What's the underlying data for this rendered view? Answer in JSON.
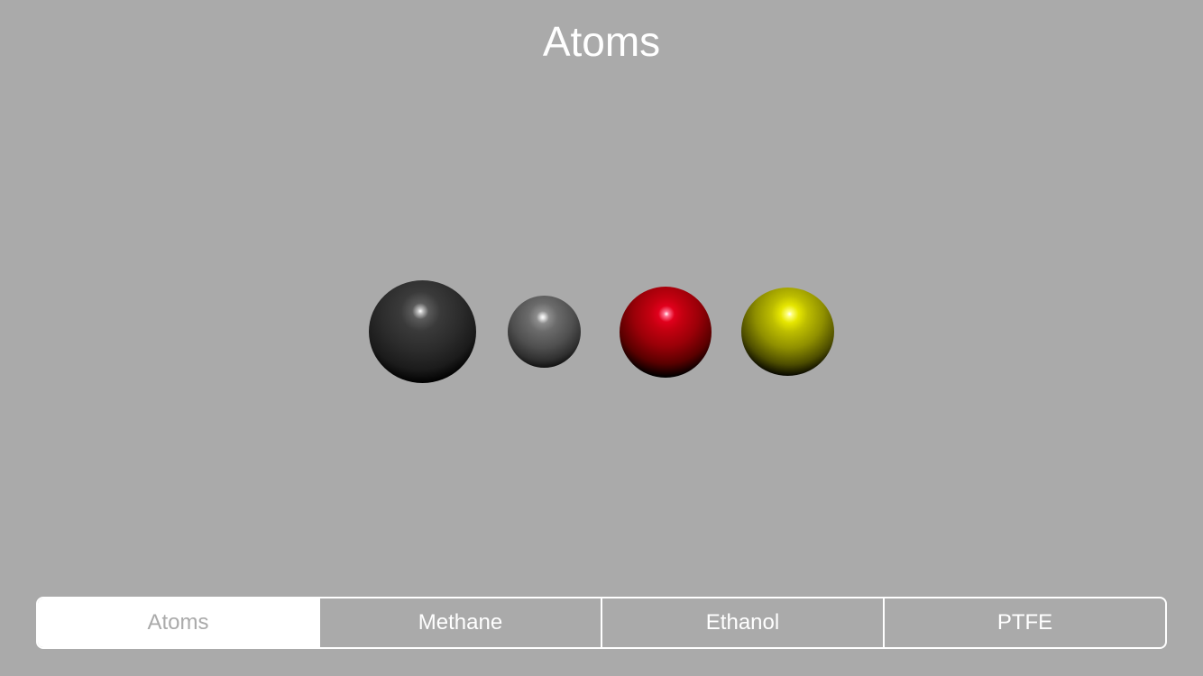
{
  "header": {
    "title": "Atoms"
  },
  "scene": {
    "atoms": [
      {
        "name": "black-sphere",
        "color": "#2b2b2b"
      },
      {
        "name": "grey-sphere",
        "color": "#6b6b6b"
      },
      {
        "name": "red-sphere",
        "color": "#c40010"
      },
      {
        "name": "yellow-sphere",
        "color": "#bdbd00"
      }
    ],
    "background_color": "#aaaaaa"
  },
  "segmented_control": {
    "selected_index": 0,
    "segments": [
      {
        "label": "Atoms"
      },
      {
        "label": "Methane"
      },
      {
        "label": "Ethanol"
      },
      {
        "label": "PTFE"
      }
    ],
    "tint_color": "#ffffff"
  }
}
